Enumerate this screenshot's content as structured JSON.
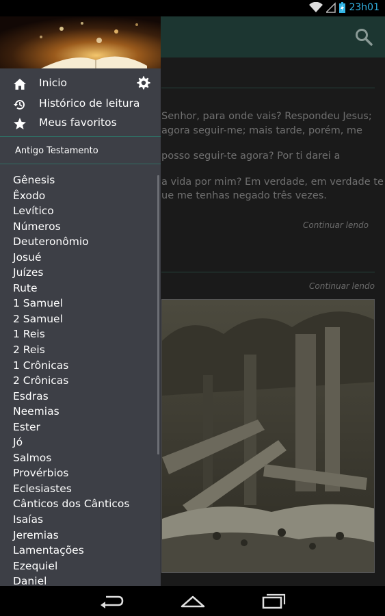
{
  "status_bar": {
    "time": "23h01"
  },
  "content": {
    "lines": [
      "Senhor, para onde vais? Respondeu Jesus;",
      "agora seguir-me; mais tarde, porém, me",
      "posso seguir-te agora? Por ti darei a",
      "a vida por mim? Em verdade, em verdade te",
      "ue me tenhas negado três vezes."
    ],
    "continue_label_1": "Continuar lendo",
    "continue_label_2": "Continuar lendo"
  },
  "drawer": {
    "menu": [
      {
        "label": "Inicio",
        "icon": "home-icon"
      },
      {
        "label": "Histórico de leitura",
        "icon": "history-icon"
      },
      {
        "label": "Meus favoritos",
        "icon": "star-icon"
      }
    ],
    "section_title": "Antigo Testamento",
    "books": [
      "Gênesis",
      "Êxodo",
      "Levítico",
      "Números",
      "Deuteronômio",
      "Josué",
      "Juízes",
      "Rute",
      "1 Samuel",
      "2 Samuel",
      "1 Reis",
      "2 Reis",
      "1 Crônicas",
      "2 Crônicas",
      "Esdras",
      "Neemias",
      "Ester",
      "Jó",
      "Salmos",
      "Provérbios",
      "Eclesiastes",
      "Cânticos dos Cânticos",
      "Isaías",
      "Jeremias",
      "Lamentações",
      "Ezequiel",
      "Daniel"
    ]
  },
  "colors": {
    "app_bar": "#1c3631",
    "drawer_bg": "#3d3f46",
    "accent_separator": "#2f6e64",
    "status_time": "#33b5e5"
  }
}
